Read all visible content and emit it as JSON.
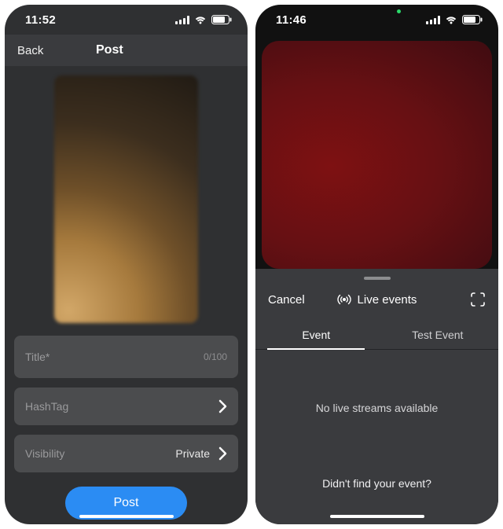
{
  "phone1": {
    "status": {
      "time": "11:52"
    },
    "nav": {
      "back": "Back",
      "title": "Post"
    },
    "form": {
      "title_placeholder": "Title*",
      "title_char": "0/100",
      "hashtag_label": "HashTag",
      "visibility_label": "Visibility",
      "visibility_value": "Private",
      "post_button": "Post"
    }
  },
  "phone2": {
    "status": {
      "time": "11:46"
    },
    "sheet": {
      "cancel": "Cancel",
      "title": "Live events",
      "tabs": {
        "event": "Event",
        "test": "Test Event"
      },
      "empty": "No live streams available",
      "hint": "Didn't find your event?"
    }
  }
}
